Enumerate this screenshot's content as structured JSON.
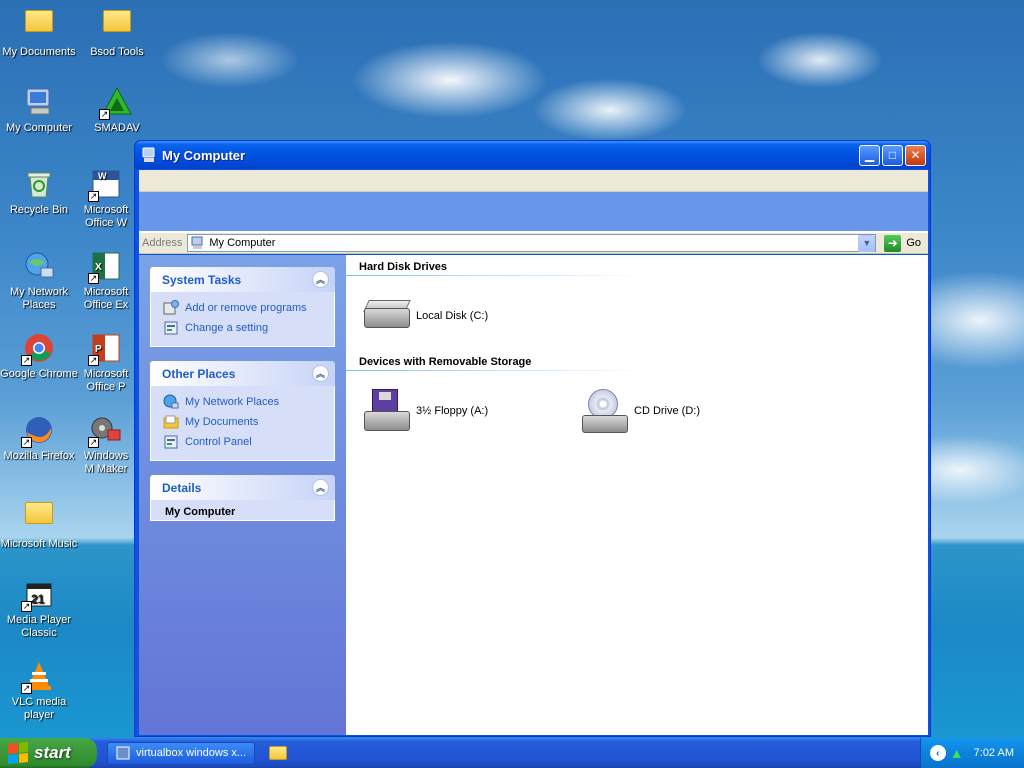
{
  "desktop": {
    "icons": [
      {
        "label": "My Documents"
      },
      {
        "label": "Bsod Tools"
      },
      {
        "label": "My Computer"
      },
      {
        "label": "SMADAV"
      },
      {
        "label": "Recycle Bin"
      },
      {
        "label": "Microsoft Office W"
      },
      {
        "label": "My Network Places"
      },
      {
        "label": "Microsoft Office Ex"
      },
      {
        "label": "Google Chrome"
      },
      {
        "label": "Microsoft Office P"
      },
      {
        "label": "Mozilla Firefox"
      },
      {
        "label": "Windows M Maker"
      },
      {
        "label": "Microsoft Music"
      },
      {
        "label": "Media Player Classic"
      },
      {
        "label": "VLC media player"
      }
    ]
  },
  "window": {
    "title": "My Computer",
    "address": {
      "label": "Address",
      "value": "My Computer",
      "go_label": "Go"
    },
    "tasks": {
      "system": {
        "title": "System Tasks",
        "links": [
          "Add or remove programs",
          "Change a setting"
        ]
      },
      "other": {
        "title": "Other Places",
        "links": [
          "My Network Places",
          "My Documents",
          "Control Panel"
        ]
      },
      "details": {
        "title": "Details",
        "name": "My Computer"
      }
    },
    "groups": {
      "hard_disks": {
        "title": "Hard Disk Drives",
        "drives": [
          "Local Disk (C:)"
        ]
      },
      "removable": {
        "title": "Devices with Removable Storage",
        "drives": [
          "3½ Floppy (A:)",
          "CD Drive (D:)"
        ]
      }
    }
  },
  "taskbar": {
    "start_label": "start",
    "items": [
      "virtualbox windows x..."
    ],
    "clock": "7:02 AM"
  }
}
